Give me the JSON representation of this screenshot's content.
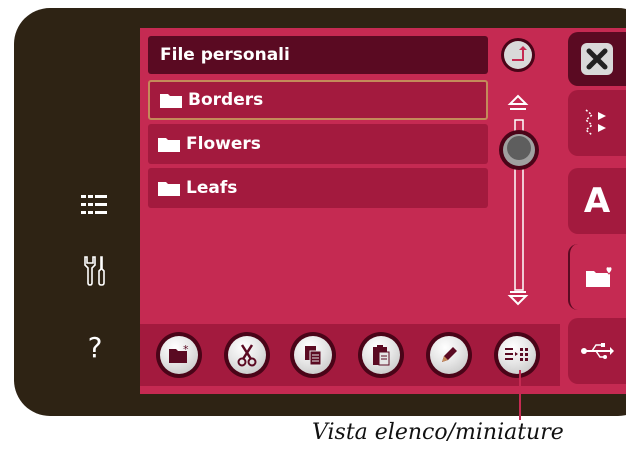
{
  "header": {
    "title": "File personali"
  },
  "folders": [
    {
      "name": "Borders",
      "icon": "folder-icon",
      "selected": true
    },
    {
      "name": "Flowers",
      "icon": "folder-icon",
      "selected": false
    },
    {
      "name": "Leafs",
      "icon": "folder-icon",
      "selected": false
    }
  ],
  "left_rail": {
    "help_label": "?"
  },
  "side_tabs": {
    "text_tab_label": "A"
  },
  "annotation": {
    "caption": "Vista elenco/miniature"
  },
  "colors": {
    "screen": "#c52a52",
    "header": "#5a0a22",
    "device": "#2e2314"
  }
}
